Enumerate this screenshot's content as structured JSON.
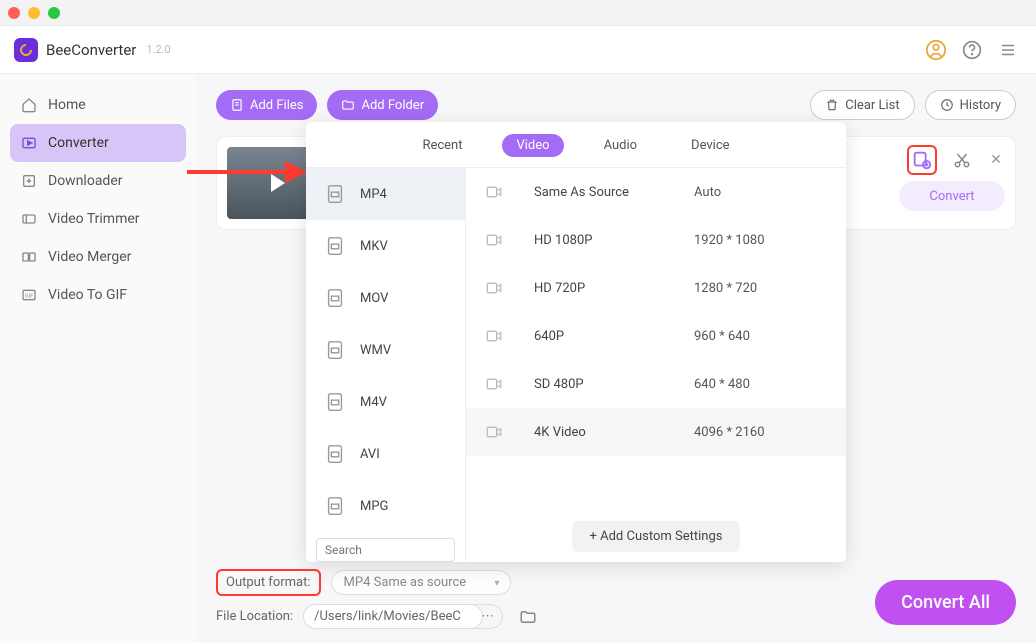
{
  "app": {
    "name": "BeeConverter",
    "version": "1.2.0"
  },
  "sidebar": {
    "items": [
      {
        "label": "Home"
      },
      {
        "label": "Converter"
      },
      {
        "label": "Downloader"
      },
      {
        "label": "Video Trimmer"
      },
      {
        "label": "Video Merger"
      },
      {
        "label": "Video To GIF"
      }
    ]
  },
  "toolbar": {
    "add_files": "Add Files",
    "add_folder": "Add Folder",
    "clear_list": "Clear List",
    "history": "History"
  },
  "file_card": {
    "convert": "Convert"
  },
  "popup": {
    "tabs": [
      "Recent",
      "Video",
      "Audio",
      "Device"
    ],
    "active_tab": 1,
    "formats": [
      "MP4",
      "MKV",
      "MOV",
      "WMV",
      "M4V",
      "AVI",
      "MPG"
    ],
    "active_format": 0,
    "resolutions": [
      {
        "label": "Same As Source",
        "dim": "Auto"
      },
      {
        "label": "HD 1080P",
        "dim": "1920 * 1080"
      },
      {
        "label": "HD 720P",
        "dim": "1280 * 720"
      },
      {
        "label": "640P",
        "dim": "960 * 640"
      },
      {
        "label": "SD 480P",
        "dim": "640 * 480"
      },
      {
        "label": "4K Video",
        "dim": "4096 * 2160"
      }
    ],
    "search_placeholder": "Search",
    "add_custom": "+ Add Custom Settings"
  },
  "bottom": {
    "output_label": "Output format:",
    "output_value": "MP4 Same as source",
    "location_label": "File Location:",
    "location_value": "/Users/link/Movies/BeeC",
    "convert_all": "Convert All"
  }
}
